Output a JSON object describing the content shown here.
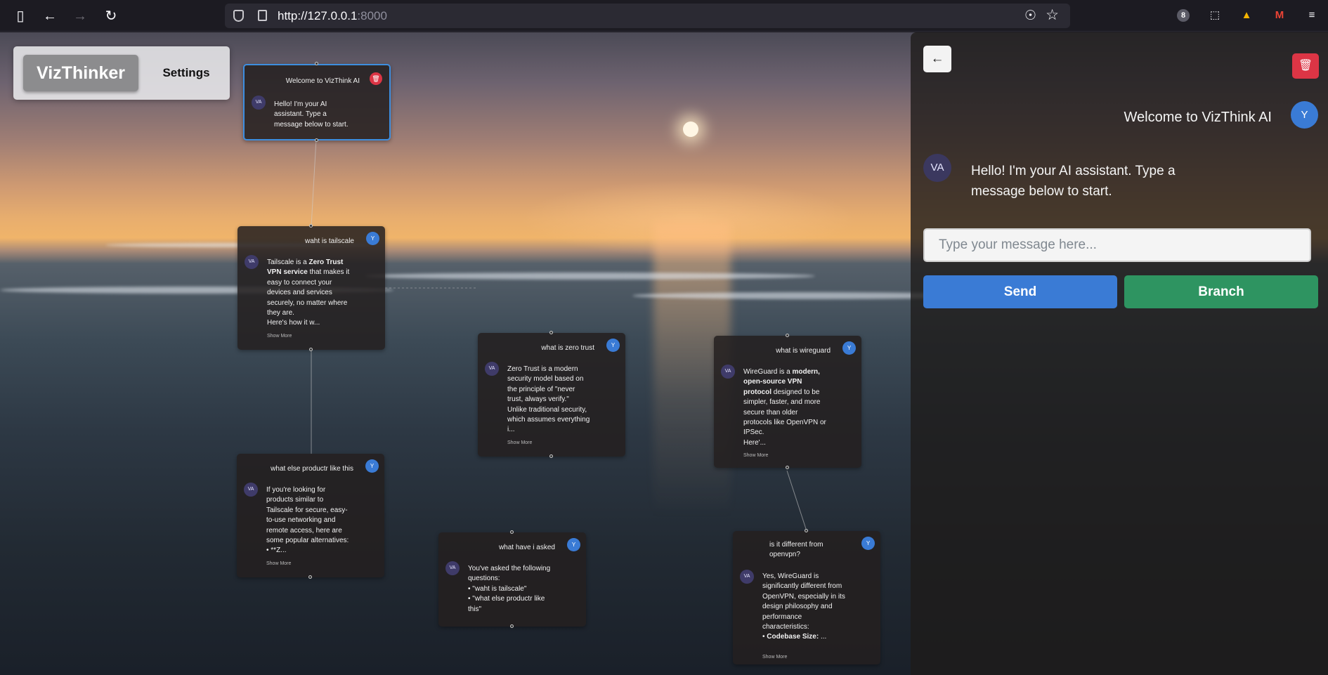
{
  "browser": {
    "url_host": "http://127.0.0.1",
    "url_port": ":8000",
    "extensions_badge": "8"
  },
  "app": {
    "logo": "VizThinker",
    "settings_label": "Settings"
  },
  "nodes": [
    {
      "question": "Welcome to VizThink AI",
      "avatar": "VA",
      "answer": "Hello! I'm your AI assistant. Type a message below to start."
    },
    {
      "question": "waht is tailscale",
      "user_avatar": "Y",
      "avatar": "VA",
      "answer_pre": "Tailscale is a ",
      "answer_bold": "Zero Trust VPN service",
      "answer_post": " that makes it easy to connect your devices and services securely, no matter where they are.",
      "answer_tail": "Here's how it w...",
      "show_more": "Show More"
    },
    {
      "question": "what is zero trust",
      "user_avatar": "Y",
      "avatar": "VA",
      "answer": "Zero Trust is a modern security model based on the principle of \"never trust, always verify.\" Unlike traditional security, which assumes everything i...",
      "show_more": "Show More"
    },
    {
      "question": "what is wireguard",
      "user_avatar": "Y",
      "avatar": "VA",
      "answer_pre": "WireGuard is a ",
      "answer_bold": "modern, open-source VPN protocol",
      "answer_post": " designed to be simpler, faster, and more secure than older protocols like OpenVPN or IPSec.",
      "answer_tail": "Here'...",
      "show_more": "Show More"
    },
    {
      "question": "what else productr like this",
      "user_avatar": "Y",
      "avatar": "VA",
      "answer": "If you're looking for products similar to Tailscale for secure, easy-to-use networking and remote access, here are some popular alternatives:",
      "bullet": "**Z...",
      "show_more": "Show More"
    },
    {
      "question": "what have i asked",
      "user_avatar": "Y",
      "avatar": "VA",
      "answer": "You've asked the following questions:",
      "bullets": [
        "\"waht is tailscale\"",
        "\"what else productr like this\""
      ]
    },
    {
      "question": "is it different from openvpn?",
      "user_avatar": "Y",
      "avatar": "VA",
      "answer": "Yes, WireGuard is significantly different from OpenVPN, especially in its design philosophy and performance characteristics:",
      "bullet_bold": "Codebase Size:",
      "bullet_post": " ...",
      "show_more": "Show More"
    }
  ],
  "chat": {
    "user_message": "Welcome to VizThink AI",
    "user_avatar": "Y",
    "ai_avatar": "VA",
    "ai_message": "Hello! I'm your AI assistant. Type a message below to start.",
    "input_placeholder": "Type your message here...",
    "input_value": "",
    "send_label": "Send",
    "branch_label": "Branch"
  },
  "colors": {
    "primary": "#3a7bd5",
    "success": "#2e9461",
    "danger": "#dc3545",
    "selected_border": "#3d8ee0"
  }
}
